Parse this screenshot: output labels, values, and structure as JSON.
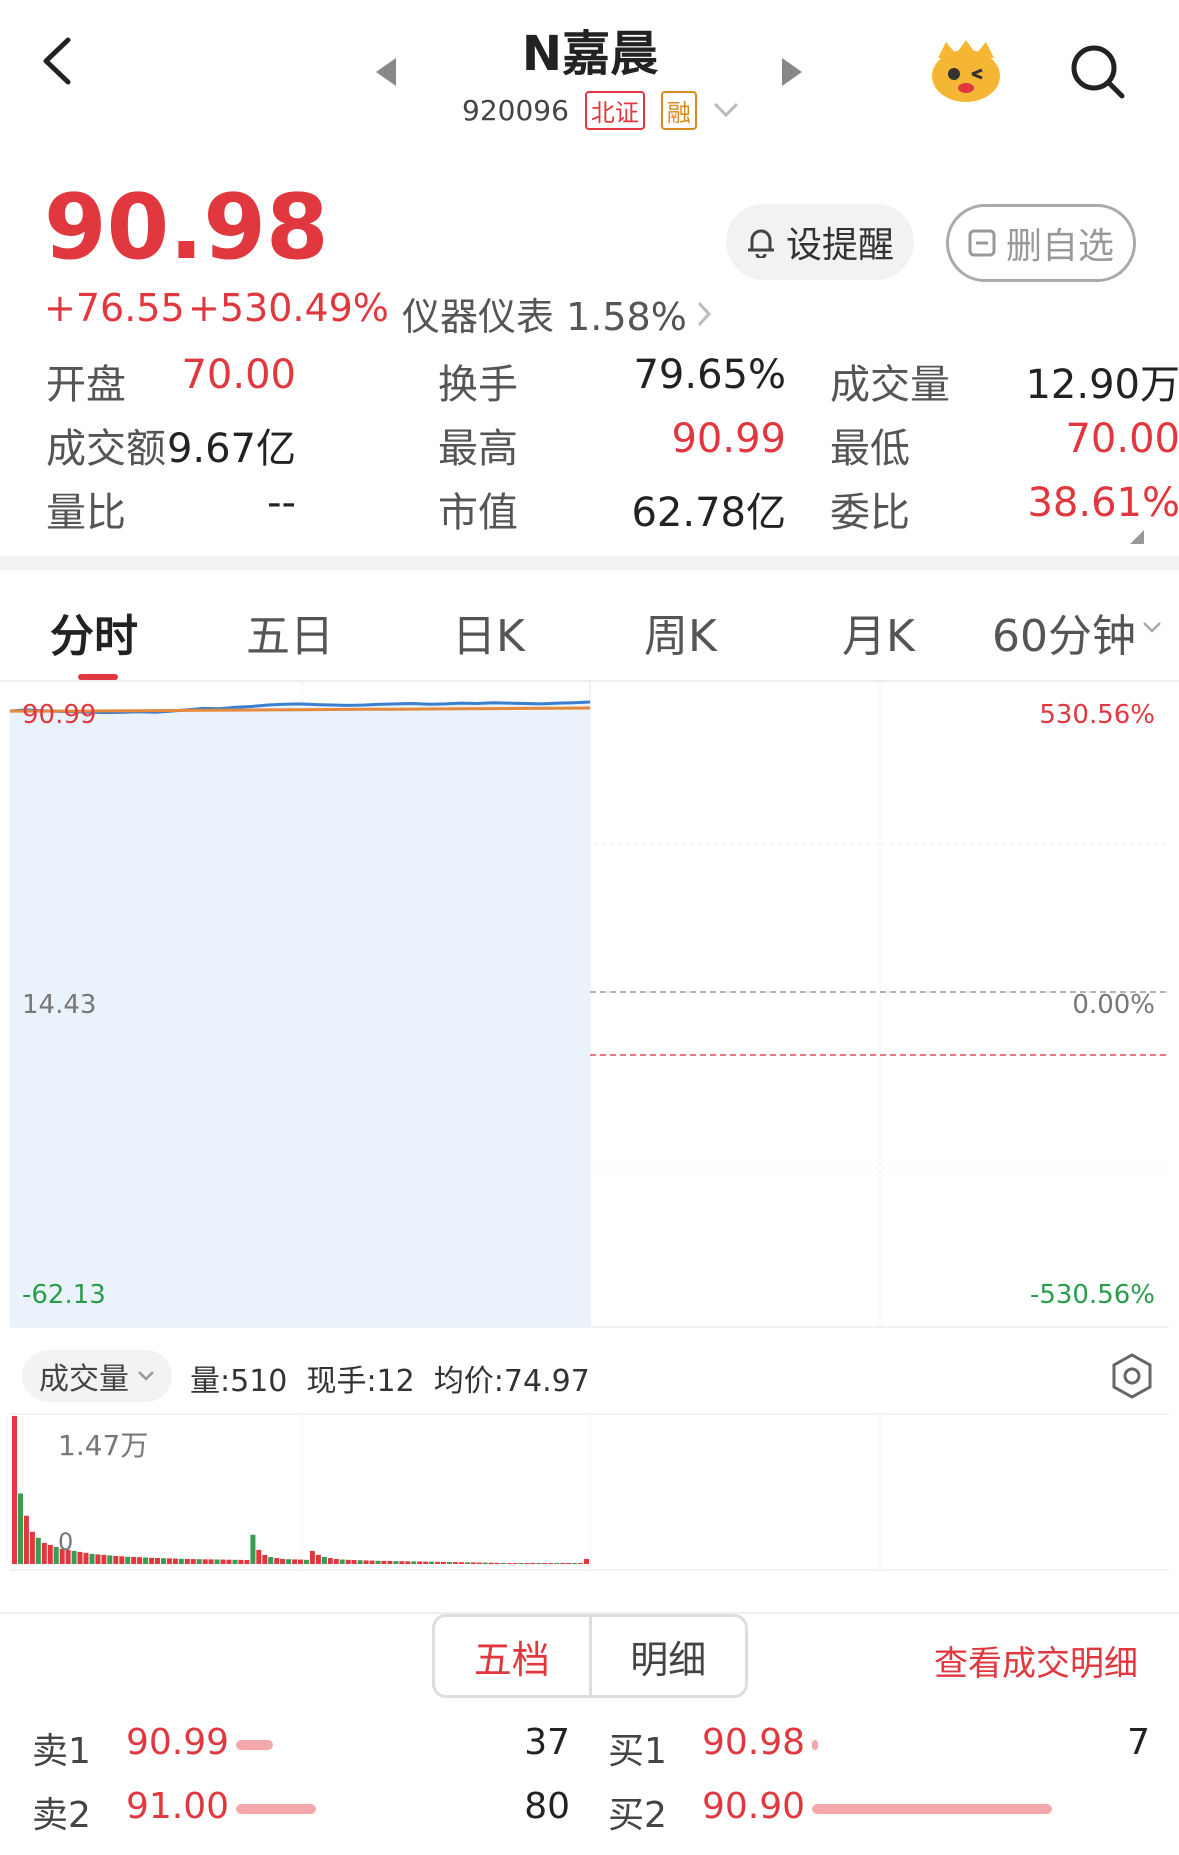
{
  "header": {
    "stock_name": "N嘉晨",
    "stock_code": "920096",
    "exchange_tag": "北证",
    "margin_tag": "融"
  },
  "quote": {
    "price": "90.98",
    "change": "+76.55",
    "change_pct": "+530.49%",
    "sector": "仪器仪表 1.58%",
    "remind_label": "设提醒",
    "watchlist_label": "删自选"
  },
  "stats": [
    {
      "label": "开盘",
      "value": "70.00",
      "color": "red"
    },
    {
      "label": "换手",
      "value": "79.65%",
      "color": "dark"
    },
    {
      "label": "成交量",
      "value": "12.90万",
      "color": "dark"
    },
    {
      "label": "成交额",
      "value": "9.67亿",
      "color": "dark"
    },
    {
      "label": "最高",
      "value": "90.99",
      "color": "red"
    },
    {
      "label": "最低",
      "value": "70.00",
      "color": "red"
    },
    {
      "label": "量比",
      "value": "--",
      "color": "dark"
    },
    {
      "label": "市值",
      "value": "62.78亿",
      "color": "dark"
    },
    {
      "label": "委比",
      "value": "38.61%",
      "color": "red"
    }
  ],
  "tabs": [
    "分时",
    "五日",
    "日K",
    "周K",
    "月K",
    "60分钟"
  ],
  "chart_axis": {
    "y_top": "90.99",
    "y_mid": "14.43",
    "y_bottom": "-62.13",
    "pct_top": "530.56%",
    "pct_mid": "0.00%",
    "pct_bottom": "-530.56%"
  },
  "volume_bar": {
    "selector": "成交量",
    "info": "量:510  现手:12  均价:74.97",
    "max_label": "1.47万",
    "zero_label": "0"
  },
  "orderbook": {
    "tab_five": "五档",
    "tab_detail": "明细",
    "view_link": "查看成交明细",
    "sell": [
      {
        "label": "卖1",
        "price": "90.99",
        "qty": "37"
      },
      {
        "label": "卖2",
        "price": "91.00",
        "qty": "80"
      }
    ],
    "buy": [
      {
        "label": "买1",
        "price": "90.98",
        "qty": "7"
      },
      {
        "label": "买2",
        "price": "90.90",
        "qty": ""
      }
    ]
  },
  "chart_data": {
    "type": "line",
    "title": "",
    "ylim": [
      -62.13,
      90.99
    ],
    "reference_price": 14.43,
    "series": [
      {
        "values": [
          88.6,
          88.9,
          88.7,
          88.5,
          88.4,
          88.3,
          88.2,
          88.3,
          88.4,
          88.3,
          88.6,
          88.9,
          89.3,
          89.2,
          89.6,
          89.8,
          90.2,
          90.4,
          90.5,
          90.3,
          90.2,
          90.1,
          90.2,
          90.4,
          90.5,
          90.6,
          90.4,
          90.5,
          90.7,
          90.6,
          90.8,
          90.7,
          90.6,
          90.5,
          90.7,
          90.8,
          90.99
        ]
      },
      {
        "values": [
          88.6,
          88.6,
          88.6,
          88.65,
          88.7,
          88.75,
          88.8,
          88.85,
          88.9,
          88.95,
          89.0,
          89.05,
          89.1,
          89.15,
          89.2,
          89.25,
          89.3,
          89.35,
          89.4
        ]
      }
    ],
    "volume": [
      14700,
      7000,
      4800,
      3200,
      2600,
      2100,
      1900,
      1700,
      1500,
      1400,
      1300,
      1200,
      1100,
      1000,
      950,
      900,
      850,
      800,
      760,
      720,
      700,
      680,
      650,
      620,
      600,
      580,
      560,
      540,
      520,
      500,
      490,
      480,
      470,
      460,
      450,
      440,
      430,
      420,
      410,
      400,
      2900,
      1400,
      900,
      700,
      600,
      500,
      480,
      460,
      440,
      420,
      1300,
      900,
      700,
      600,
      500,
      450,
      420,
      400,
      380,
      360,
      340,
      320,
      310,
      300,
      290,
      280,
      270,
      260,
      250,
      240,
      230,
      220,
      210,
      200,
      190,
      180,
      170,
      160,
      150,
      140,
      130,
      120,
      110,
      100,
      95,
      90,
      85,
      80,
      75,
      70,
      65,
      60,
      55,
      50,
      45,
      40,
      510
    ]
  }
}
